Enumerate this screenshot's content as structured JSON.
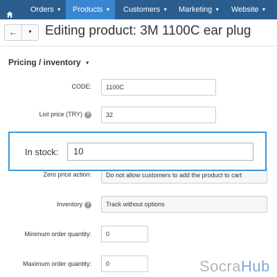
{
  "nav": {
    "items": [
      {
        "label": "Orders"
      },
      {
        "label": "Products"
      },
      {
        "label": "Customers"
      },
      {
        "label": "Marketing"
      },
      {
        "label": "Website"
      }
    ],
    "active_index": 1
  },
  "header": {
    "back_glyph": "←",
    "title": "Editing product: 3M 1100C ear plug"
  },
  "section": {
    "title": "Pricing / inventory"
  },
  "fields": {
    "code": {
      "label": "CODE:",
      "value": "1100C"
    },
    "list_price": {
      "label": "List price (TRY)",
      "value": "32"
    },
    "in_stock": {
      "label": "In stock:",
      "value": "10"
    },
    "zero_price": {
      "label": "Zero price action:",
      "value": "Do not allow customers to add the product to cart"
    },
    "inventory": {
      "label": "Inventory",
      "value": "Track without options"
    },
    "min_qty": {
      "label": "Minimum order quantity:",
      "value": "0"
    },
    "max_qty": {
      "label": "Maximum order quantity:",
      "value": "0"
    }
  },
  "watermark": {
    "part1": "Socra",
    "part2": "Hub"
  },
  "colors": {
    "nav_bg": "#2b5d8f",
    "nav_active": "#3a86d0",
    "callout_border": "#3a96db"
  }
}
